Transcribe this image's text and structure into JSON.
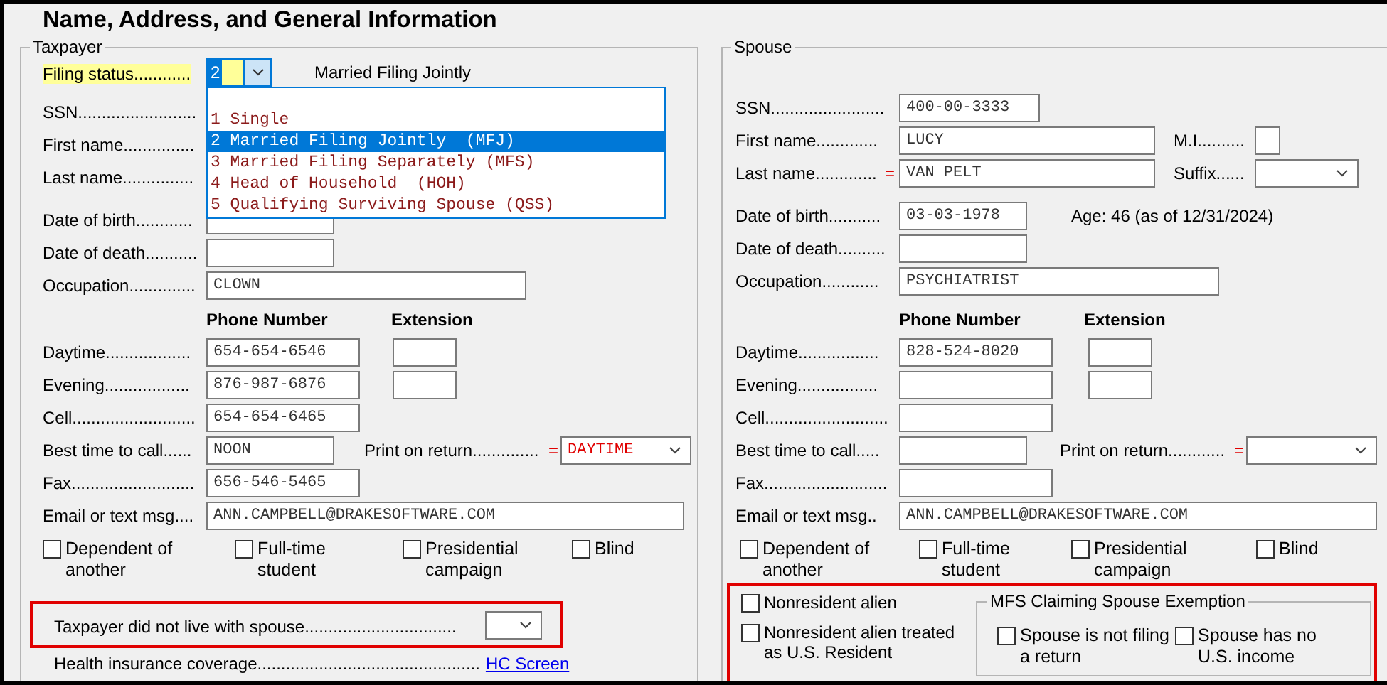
{
  "title": "Name, Address, and General Information",
  "taxpayer": {
    "legend": "Taxpayer",
    "filing_status": {
      "label": "Filing status............",
      "value": "2",
      "description": "Married Filing Jointly",
      "options": [
        {
          "number": "1",
          "text": "Single",
          "selected": false
        },
        {
          "number": "2",
          "text": "Married Filing Jointly  (MFJ)",
          "selected": true
        },
        {
          "number": "3",
          "text": "Married Filing Separately (MFS)",
          "selected": false
        },
        {
          "number": "4",
          "text": "Head of Household  (HOH)",
          "selected": false
        },
        {
          "number": "5",
          "text": "Qualifying Surviving Spouse (QSS)",
          "selected": false
        }
      ]
    },
    "rows": [
      {
        "kind": "ssn",
        "label": "SSN........................."
      },
      {
        "kind": "name",
        "label": "First name..............."
      },
      {
        "kind": "name",
        "label": "Last name..............."
      },
      {
        "kind": "date",
        "label": "Date of birth............"
      },
      {
        "kind": "date",
        "label": "Date of death..........."
      },
      {
        "kind": "wide",
        "label": "Occupation..............",
        "value": "CLOWN"
      },
      {
        "kind": "header",
        "phone": "Phone Number",
        "extension": "Extension"
      },
      {
        "kind": "phone_ext",
        "label": "Daytime..................",
        "value": "654-654-6546"
      },
      {
        "kind": "phone_ext",
        "label": "Evening..................",
        "value": "876-987-6876"
      },
      {
        "kind": "phone",
        "label": "Cell..........................",
        "value": "654-654-6465"
      },
      {
        "kind": "best",
        "label": "Best time to call......",
        "value": "NOON",
        "print_label": "Print on return..............",
        "print_marker": "=",
        "print_value": "DAYTIME"
      },
      {
        "kind": "phone",
        "label": "Fax..........................",
        "value": "656-546-5465"
      },
      {
        "kind": "email",
        "label": "Email or text msg....",
        "value": "ANN.CAMPBELL@DRAKESOFTWARE.COM"
      }
    ],
    "checkboxes": [
      {
        "label": "Dependent of another",
        "checked": false
      },
      {
        "label": "Full-time student",
        "checked": false
      },
      {
        "label": "Presidential campaign",
        "checked": false
      },
      {
        "label": "Blind",
        "checked": false
      }
    ],
    "lived_apart": {
      "label": "Taxpayer did not live with spouse................................"
    },
    "health": {
      "label": "Health insurance coverage...............................................",
      "link": "HC Screen"
    }
  },
  "spouse": {
    "legend": "Spouse",
    "rows": [
      {
        "kind": "ssn",
        "label": "SSN........................",
        "value": "400-00-3333"
      },
      {
        "kind": "name",
        "label": "First name.............",
        "value": "LUCY",
        "side": {
          "kind": "mi",
          "label": "M.I.........."
        }
      },
      {
        "kind": "name",
        "label": "Last name.............",
        "marker": "=",
        "value": "VAN PELT",
        "side": {
          "kind": "suffix",
          "label": "Suffix......"
        }
      },
      {
        "kind": "date",
        "label": "Date of birth...........",
        "value": "03-03-1978",
        "age": "Age: 46 (as of 12/31/2024)"
      },
      {
        "kind": "date",
        "label": "Date of death.........."
      },
      {
        "kind": "wide",
        "label": "Occupation............",
        "value": "PSYCHIATRIST"
      },
      {
        "kind": "header",
        "phone": "Phone Number",
        "extension": "Extension"
      },
      {
        "kind": "phone_ext",
        "label": "Daytime.................",
        "value": "828-524-8020"
      },
      {
        "kind": "phone_ext",
        "label": "Evening................."
      },
      {
        "kind": "phone",
        "label": "Cell.........................."
      },
      {
        "kind": "best",
        "label": "Best time to call.....",
        "print_label": "Print on return............",
        "print_marker": "="
      },
      {
        "kind": "phone",
        "label": "Fax.........................."
      },
      {
        "kind": "email",
        "label": "Email or text msg..",
        "value": "ANN.CAMPBELL@DRAKESOFTWARE.COM"
      }
    ],
    "checkboxes": [
      {
        "label": "Dependent of another",
        "checked": false
      },
      {
        "label": "Full-time student",
        "checked": false
      },
      {
        "label": "Presidential campaign",
        "checked": false
      },
      {
        "label": "Blind",
        "checked": false
      }
    ],
    "nonresident": [
      {
        "label": "Nonresident alien",
        "checked": false
      },
      {
        "label": "Nonresident alien treated as U.S. Resident",
        "checked": false
      }
    ],
    "mfs": {
      "legend": "MFS Claiming Spouse Exemption",
      "checkboxes": [
        {
          "label": "Spouse is not filing a return",
          "checked": false
        },
        {
          "label": "Spouse has no U.S. income",
          "checked": false
        }
      ]
    }
  }
}
